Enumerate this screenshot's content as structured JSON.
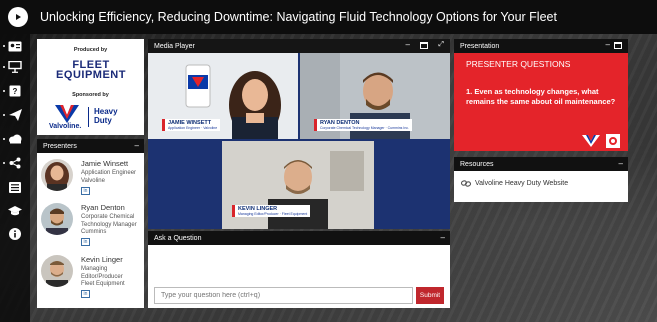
{
  "header": {
    "title": "Unlocking Efficiency, Reducing Downtime: Navigating Fluid Technology Options for Your Fleet"
  },
  "rail": {
    "icons": [
      "home-icon",
      "id-card-icon",
      "presentation-screen-icon",
      "help-icon",
      "send-icon",
      "cloud-icon",
      "share-icon",
      "list-icon",
      "graduation-cap-icon",
      "info-icon"
    ]
  },
  "sponsor": {
    "produced_by": "Produced by",
    "fleet_line1": "FLEET",
    "fleet_line2": "EQUIPMENT",
    "sponsored_by": "Sponsored by",
    "valvoline": "Valvoline.",
    "heavy_line1": "Heavy",
    "heavy_line2": "Duty"
  },
  "presenters_panel": {
    "title": "Presenters",
    "items": [
      {
        "name": "Jamie Winsett",
        "role_lines": [
          "Application Engineer",
          "Valvoline"
        ],
        "linkedin": "in"
      },
      {
        "name": "Ryan Denton",
        "role_lines": [
          "Corporate Chemical",
          "Technology Manager",
          "Cummins"
        ],
        "linkedin": "in"
      },
      {
        "name": "Kevin Linger",
        "role_lines": [
          "Managing",
          "Editor/Producer",
          "Fleet Equipment"
        ],
        "linkedin": "in"
      }
    ]
  },
  "media_player": {
    "title": "Media Player",
    "tags": [
      {
        "name": "JAMIE WINSETT",
        "sub": "Application Engineer · Valvoline"
      },
      {
        "name": "RYAN DENTON",
        "sub": "Corporate Chemical Technology Manager · Cummins Inc."
      },
      {
        "name": "KEVIN LINGER",
        "sub": "Managing Editor/Producer · Fleet Equipment"
      }
    ]
  },
  "ask": {
    "title": "Ask a Question",
    "placeholder": "Type your question here (ctrl+q)",
    "submit": "Submit"
  },
  "presentation": {
    "title": "Presentation",
    "slide_title": "PRESENTER QUESTIONS",
    "slide_question": "1. Even as technology changes, what remains the same about oil maintenance?"
  },
  "resources": {
    "title": "Resources",
    "link": "Valvoline Heavy Duty Website"
  },
  "colors": {
    "brand_red": "#e4242a",
    "fleet_blue": "#1a2a78",
    "media_blue": "#1c3271"
  }
}
